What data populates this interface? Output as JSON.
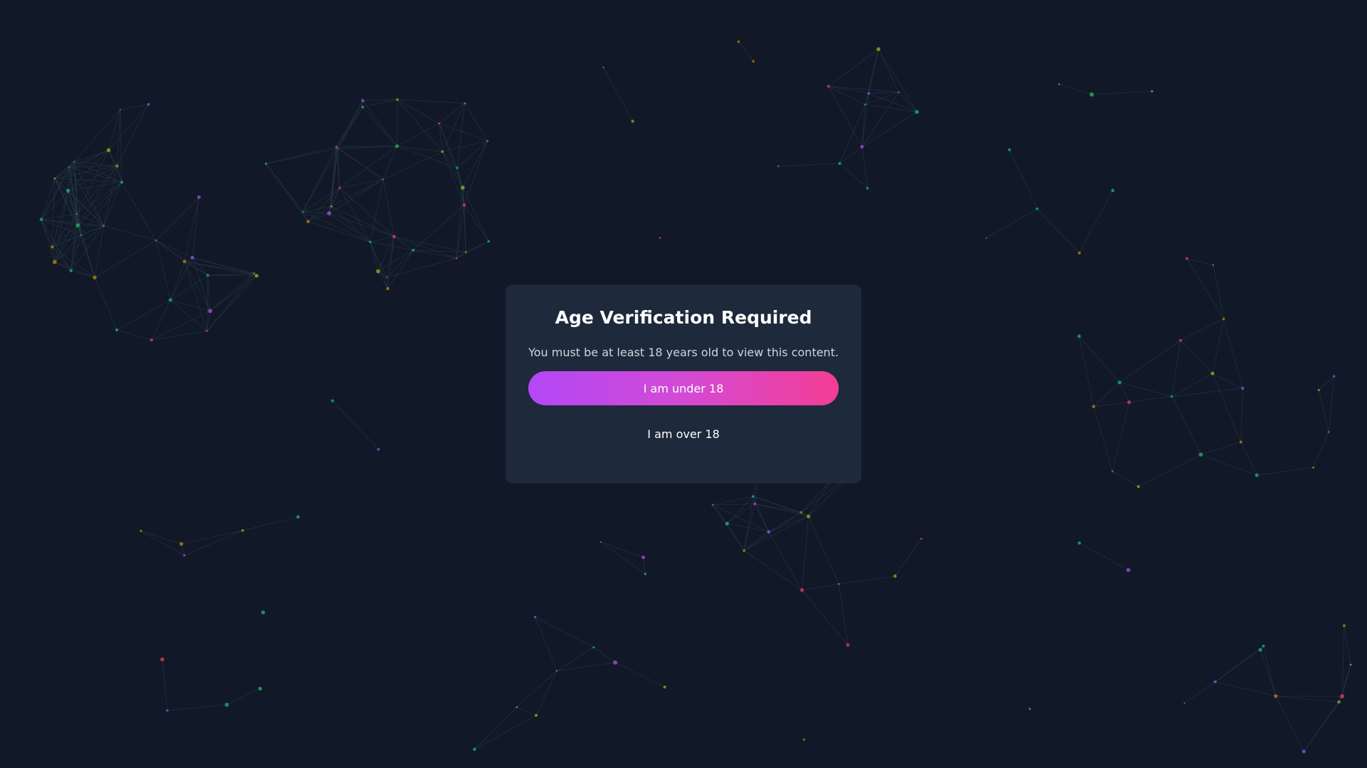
{
  "background": {
    "color": "#111827",
    "line_color": "#2a3a48",
    "node_colors": [
      "#14b8a6",
      "#a855f7",
      "#ca8a04",
      "#84cc16",
      "#f43f5e",
      "#22c55e"
    ]
  },
  "modal": {
    "title": "Age Verification Required",
    "message": "You must be at least 18 years old to view this content.",
    "under_label": "I am under 18",
    "over_label": "I am over 18",
    "gradient_start": "#b347f7",
    "gradient_end": "#f43e95"
  }
}
